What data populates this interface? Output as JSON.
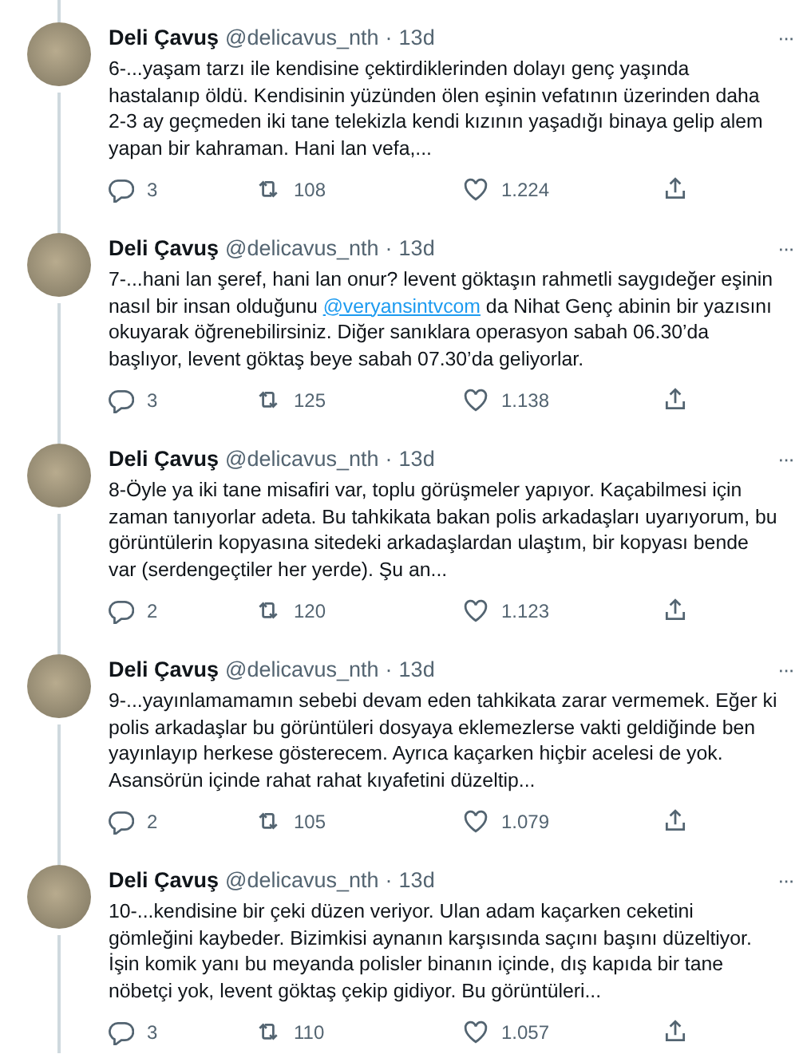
{
  "tweets": [
    {
      "name": "Deli Çavuş",
      "handle": "@delicavus_nth",
      "separator": "·",
      "time": "13d",
      "more": "···",
      "lines": [
        "6-...yaşam tarzı ile kendisine çektirdiklerinden dolayı genç yaşında",
        "hastalanıp öldü. Kendisinin yüzünden ölen eşinin vefatının üzerinden daha",
        "2-3 ay geçmeden iki tane telekizla kendi kızının yaşadığı binaya gelip alem",
        "yapan bir kahraman. Hani lan vefa,..."
      ],
      "replies": "3",
      "retweets": "108",
      "likes": "1.224"
    },
    {
      "name": "Deli Çavuş",
      "handle": "@delicavus_nth",
      "separator": "·",
      "time": "13d",
      "more": "···",
      "lines": [
        "7-...hani lan şeref, hani lan onur? levent göktaşın rahmetli saygıdeğer eşinin",
        [
          {
            "kind": "text",
            "text": "nasıl bir insan olduğunu "
          },
          {
            "kind": "mention",
            "text": "@veryansintvcom"
          },
          {
            "kind": "text",
            "text": " da Nihat Genç abinin bir yazısını"
          }
        ],
        "okuyarak öğrenebilirsiniz. Diğer sanıklara operasyon sabah 06.30’da",
        "başlıyor, levent göktaş beye sabah 07.30’da geliyorlar."
      ],
      "replies": "3",
      "retweets": "125",
      "likes": "1.138"
    },
    {
      "name": "Deli Çavuş",
      "handle": "@delicavus_nth",
      "separator": "·",
      "time": "13d",
      "more": "···",
      "lines": [
        "8-Öyle ya iki tane misafiri var, toplu görüşmeler yapıyor. Kaçabilmesi için",
        "zaman tanıyorlar adeta. Bu tahkikata bakan polis arkadaşları uyarıyorum, bu",
        "görüntülerin kopyasına sitedeki arkadaşlardan ulaştım, bir kopyası bende",
        "var (serdengeçtiler her yerde). Şu an..."
      ],
      "replies": "2",
      "retweets": "120",
      "likes": "1.123"
    },
    {
      "name": "Deli Çavuş",
      "handle": "@delicavus_nth",
      "separator": "·",
      "time": "13d",
      "more": "···",
      "lines": [
        "9-...yayınlamamamın sebebi devam eden tahkikata zarar vermemek. Eğer ki",
        "polis arkadaşlar bu görüntüleri dosyaya eklemezlerse vakti geldiğinde ben",
        "yayınlayıp herkese gösterecem. Ayrıca kaçarken hiçbir acelesi de yok.",
        "Asansörün içinde rahat rahat kıyafetini düzeltip..."
      ],
      "replies": "2",
      "retweets": "105",
      "likes": "1.079"
    },
    {
      "name": "Deli Çavuş",
      "handle": "@delicavus_nth",
      "separator": "·",
      "time": "13d",
      "more": "···",
      "lines": [
        "10-...kendisine bir çeki düzen veriyor. Ulan adam kaçarken ceketini",
        "gömleğini kaybeder. Bizimkisi aynanın karşısında saçını başını düzeltiyor.",
        "İşin komik yanı bu meyanda polisler binanın içinde, dış kapıda bir tane",
        "nöbetçi yok, levent göktaş çekip gidiyor. Bu görüntüleri..."
      ],
      "replies": "3",
      "retweets": "110",
      "likes": "1.057"
    }
  ]
}
